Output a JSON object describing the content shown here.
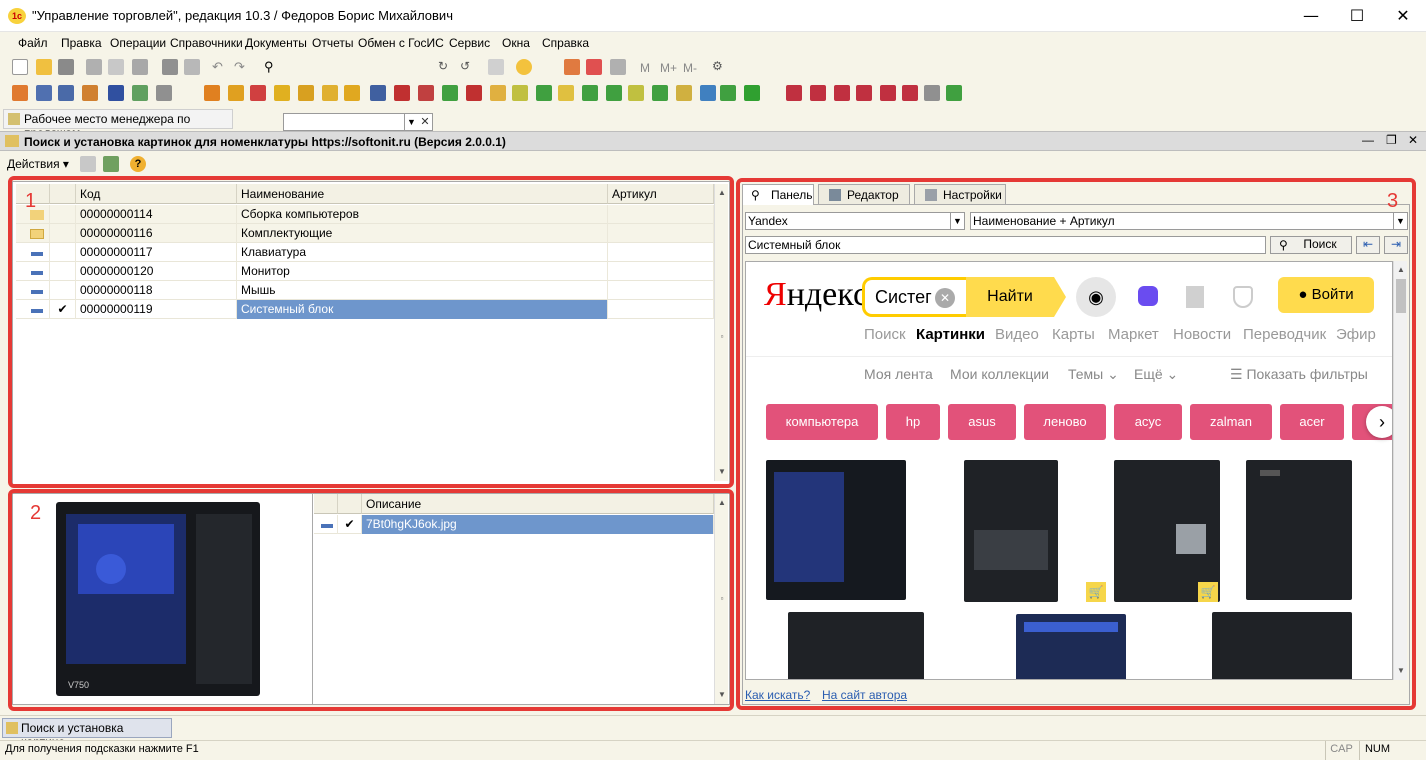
{
  "window": {
    "title": "\"Управление торговлей\", редакция 10.3 / Федоров Борис Михайлович"
  },
  "menu": [
    "Файл",
    "Правка",
    "Операции",
    "Справочники",
    "Документы",
    "Отчеты",
    "Обмен с ГосИС",
    "Сервис",
    "Окна",
    "Справка"
  ],
  "toolbar": {
    "mplus": "M",
    "mplus2": "M+",
    "mminus": "M-"
  },
  "workspace_button": "Рабочее место менеджера по продажам",
  "form": {
    "title": "Поиск и установка картинок для номенклатуры https://softonit.ru (Версия 2.0.0.1)",
    "actions_label": "Действия"
  },
  "grid": {
    "columns": {
      "code": "Код",
      "name": "Наименование",
      "article": "Артикул"
    },
    "rows": [
      {
        "code": "00000000114",
        "name": "Сборка компьютеров",
        "article": ""
      },
      {
        "code": "00000000116",
        "name": "Комплектующие",
        "article": ""
      },
      {
        "code": "00000000117",
        "name": "Клавиатура",
        "article": ""
      },
      {
        "code": "00000000120",
        "name": "Монитор",
        "article": ""
      },
      {
        "code": "00000000118",
        "name": "Мышь",
        "article": ""
      },
      {
        "code": "00000000119",
        "name": "Системный блок",
        "article": ""
      }
    ]
  },
  "annotations": {
    "n1": "1",
    "n2": "2",
    "n3": "3"
  },
  "images": {
    "header": "Описание",
    "row": "7Bt0hgKJ6ok.jpg",
    "overlay_text": "V750"
  },
  "right": {
    "tabs": [
      "Панель",
      "Редактор",
      "Настройки"
    ],
    "engine": "Yandex",
    "mode": "Наименование + Артикул",
    "query": "Системный блок",
    "search_btn": "Поиск"
  },
  "yandex": {
    "logo_a": "Я",
    "logo_b": "ндекс",
    "search_text": "Систег",
    "find": "Найти",
    "login": "Войти",
    "nav": [
      "Поиск",
      "Картинки",
      "Видео",
      "Карты",
      "Маркет",
      "Новости",
      "Переводчик",
      "Эфир"
    ],
    "sub": [
      "Моя лента",
      "Мои коллекции",
      "Темы",
      "Ещё"
    ],
    "filters": "Показать фильтры",
    "chips": [
      "компьютера",
      "hp",
      "asus",
      "леново",
      "асус",
      "zalman",
      "acer"
    ]
  },
  "links": {
    "how": "Как искать?",
    "author": "На сайт автора"
  },
  "taskbar": {
    "item": "Поиск и установка картино..."
  },
  "status": {
    "hint": "Для получения подсказки нажмите F1",
    "cap": "CAP",
    "num": "NUM"
  },
  "colors": {
    "accent_red": "#e53935",
    "selection": "#6e96cc",
    "yandex_yellow": "#ffdb4d",
    "chip_pink": "#e2527a"
  }
}
